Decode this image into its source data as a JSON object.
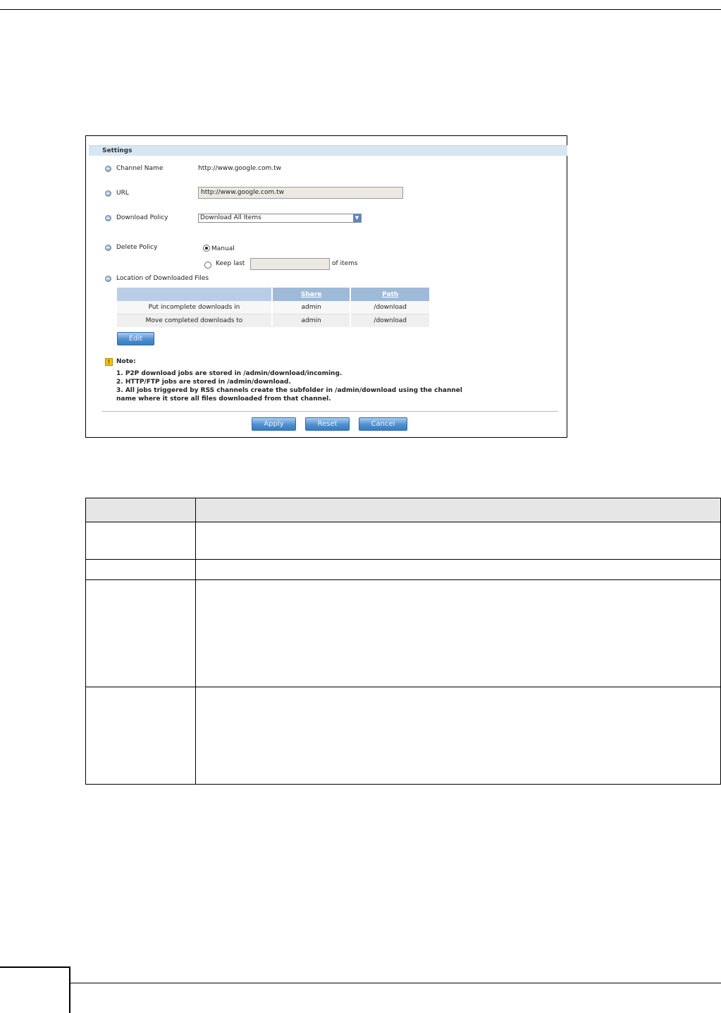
{
  "settings": {
    "title": "Settings",
    "channel_name_label": "Channel Name",
    "channel_name_value": "http://www.google.com.tw",
    "url_label": "URL",
    "url_value": "http://www.google.com.tw",
    "download_policy_label": "Download Policy",
    "download_policy_value": "Download All Items",
    "delete_policy_label": "Delete Policy",
    "manual_label": "Manual",
    "keep_last_label": "Keep last",
    "of_items_label": "of items",
    "keep_last_value": "",
    "location_label": "Location of Downloaded Files"
  },
  "location_table": {
    "headers": [
      "",
      "Share",
      "Path"
    ],
    "rows": [
      [
        "Put incomplete downloads in",
        "admin",
        "/download"
      ],
      [
        "Move completed downloads to",
        "admin",
        "/download"
      ]
    ]
  },
  "edit_button": "Edit",
  "note": {
    "label": "Note:",
    "lines": [
      "1. P2P download jobs are stored in /admin/download/incoming.",
      "2. HTTP/FTP jobs are stored in /admin/download.",
      "3. All jobs triggered by RSS channels create the subfolder in /admin/download using the channel",
      "name where it store all files downloaded from that channel."
    ]
  },
  "buttons": {
    "apply": "Apply",
    "reset": "Reset",
    "cancel": "Cancel"
  },
  "selected_delete_policy": "Manual"
}
